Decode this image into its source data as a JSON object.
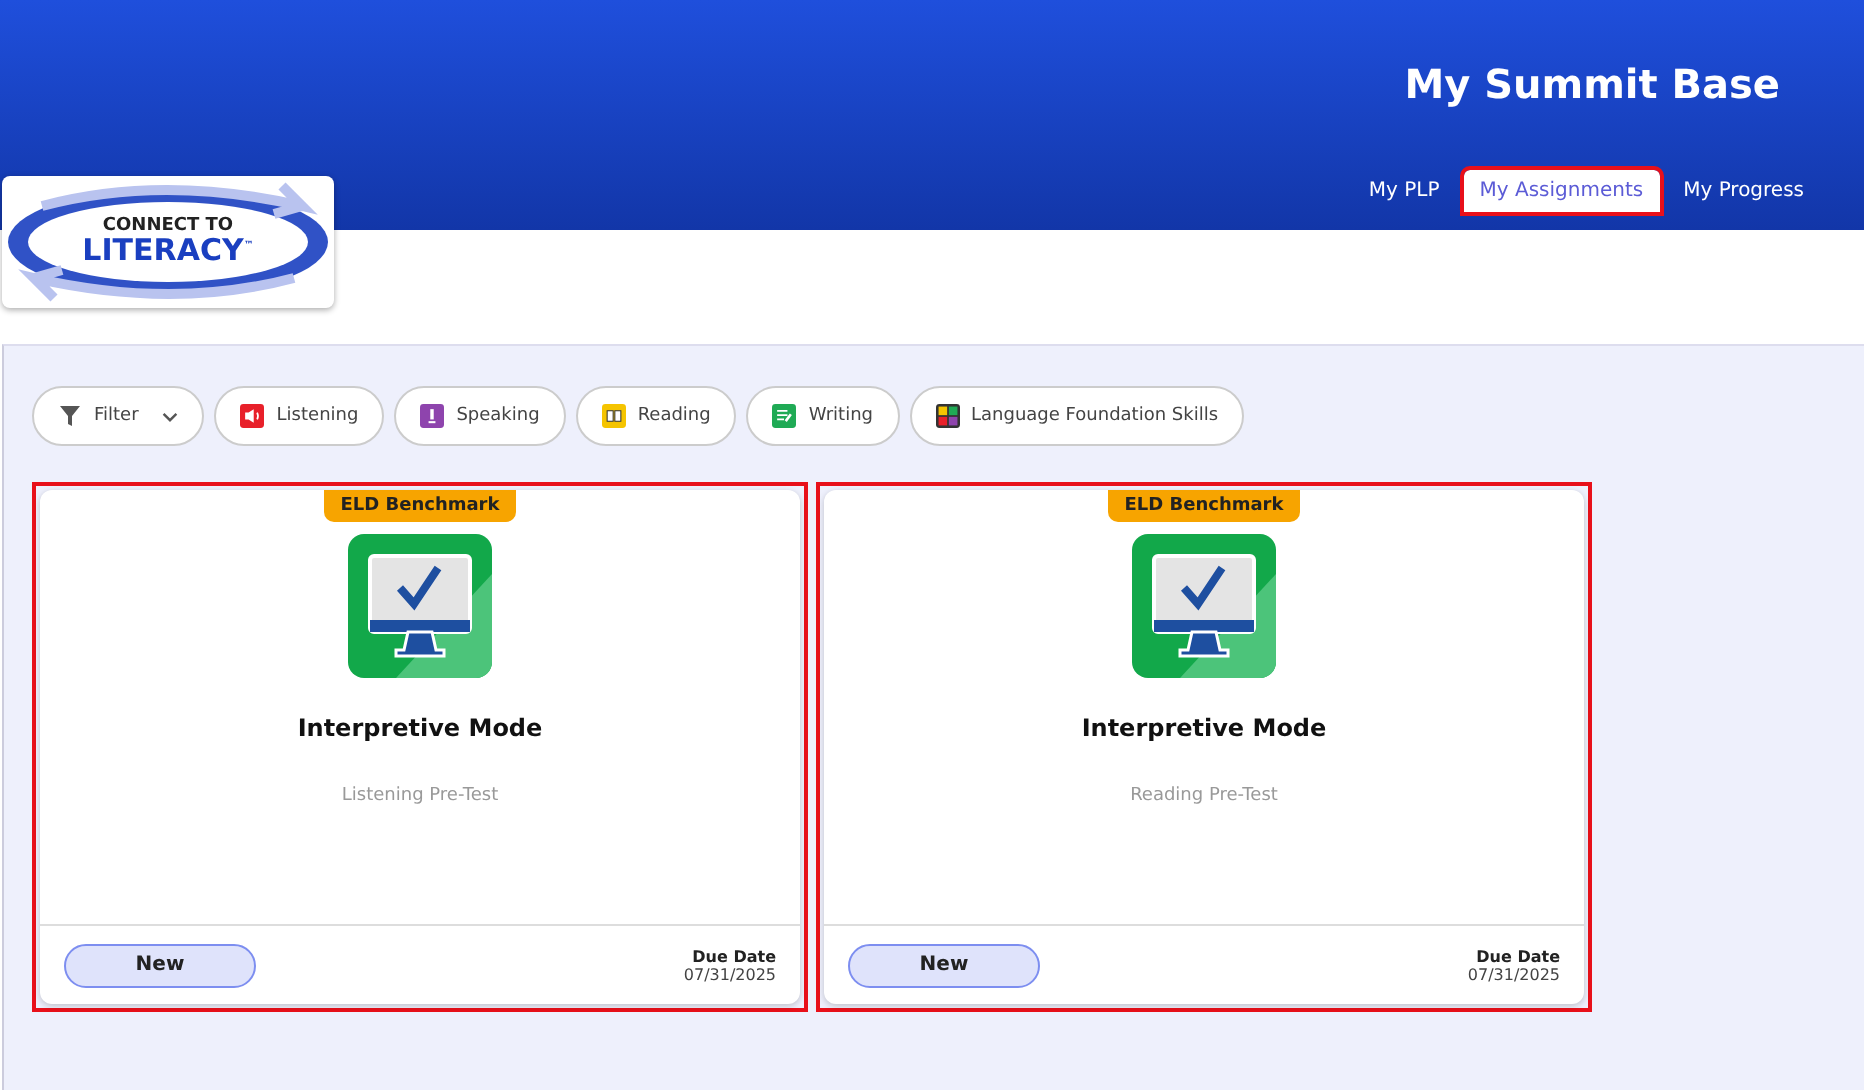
{
  "header": {
    "title": "My Summit Base",
    "logo": {
      "line_1": "CONNECT TO",
      "line_2": "LITERACY",
      "mark": "™"
    }
  },
  "nav": [
    {
      "label": "My PLP",
      "selected": false,
      "highlighted": false
    },
    {
      "label": "My Assignments",
      "selected": true,
      "highlighted": true
    },
    {
      "label": "My Progress",
      "selected": false,
      "highlighted": false
    }
  ],
  "filters": [
    {
      "kind": "filter",
      "label": "Filter"
    },
    {
      "kind": "listening",
      "label": "Listening"
    },
    {
      "kind": "speaking",
      "label": "Speaking"
    },
    {
      "kind": "reading",
      "label": "Reading"
    },
    {
      "kind": "writing",
      "label": "Writing"
    },
    {
      "kind": "foundation",
      "label": "Language Foundation Skills"
    }
  ],
  "cards": [
    {
      "badge": "ELD Benchmark",
      "title": "Interpretive Mode",
      "subtitle": "Listening Pre-Test",
      "status": "New",
      "due_label": "Due Date",
      "due_date": "07/31/2025",
      "highlighted": true
    },
    {
      "badge": "ELD Benchmark",
      "title": "Interpretive Mode",
      "subtitle": "Reading Pre-Test",
      "status": "New",
      "due_label": "Due Date",
      "due_date": "07/31/2025",
      "highlighted": true
    }
  ]
}
